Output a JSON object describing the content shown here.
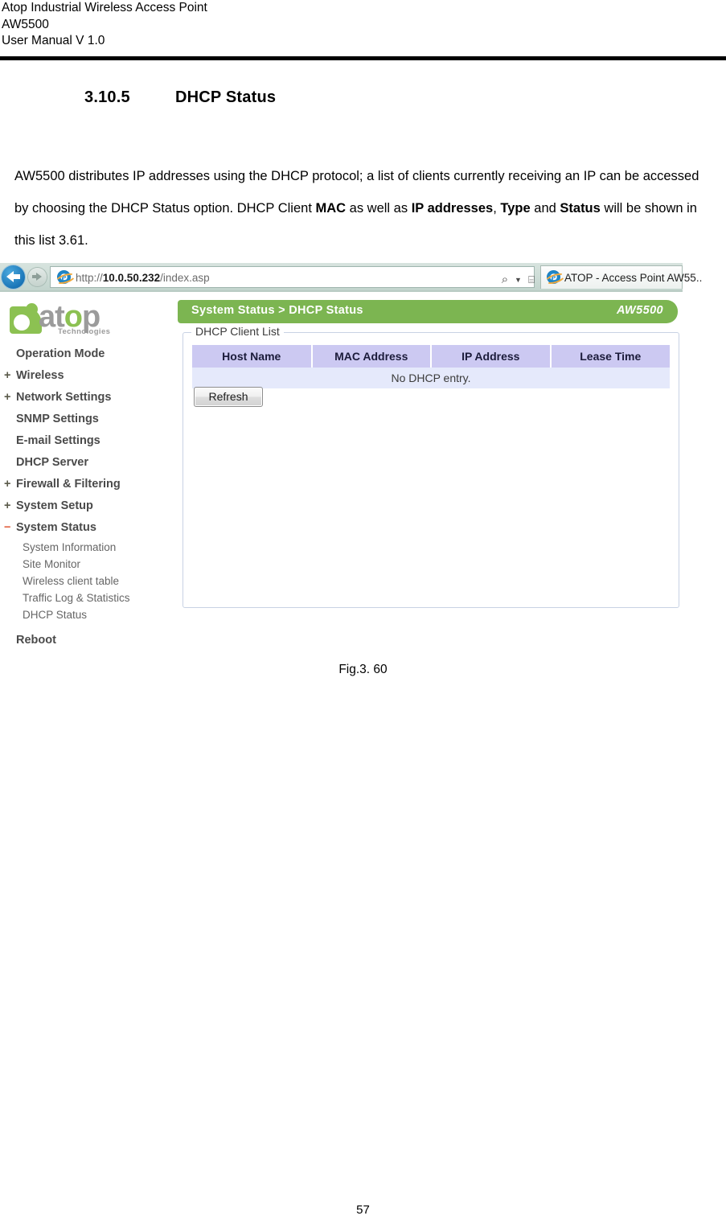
{
  "document": {
    "header_lines": [
      "Atop Industrial Wireless Access Point",
      "AW5500",
      "User Manual V 1.0"
    ],
    "section": {
      "number": "3.10.5",
      "title": "DHCP Status"
    },
    "paragraph": {
      "part1": "AW5500 distributes IP addresses using the DHCP protocol; a list of clients currently receiving an IP can be accessed by choosing the DHCP Status option. DHCP Client ",
      "bold1": "MAC",
      "part2": " as well as ",
      "bold2": "IP addresses",
      "part3": ", ",
      "bold3": "Type",
      "part4": " and ",
      "bold4": "Status",
      "part5": " will be shown in this list 3.61."
    },
    "figure_caption": "Fig.3. 60",
    "page_number": "57"
  },
  "browser": {
    "back_icon": "back-arrow-icon",
    "forward_icon": "forward-arrow-icon",
    "url": {
      "scheme": "http://",
      "host": "10.0.50.232",
      "path": "/index.asp",
      "full": "http://10.0.50.232/index.asp"
    },
    "address_icons": {
      "search": "⌕",
      "caret": "▼",
      "compatibility": "⌸",
      "refresh": "↻",
      "stop": "✕"
    },
    "tab": {
      "title": "ATOP - Access Point AW55..",
      "favicon": "ie-logo-icon"
    }
  },
  "device_ui": {
    "logo": {
      "word_at": "at",
      "word_o": "o",
      "word_p": "p",
      "subtitle": "Technologies",
      "green": "#8cc152",
      "gray": "#9b9b9b"
    },
    "titlebar": {
      "breadcrumb": "System Status > DHCP Status",
      "model": "AW5500",
      "color": "#7cb551"
    },
    "sidebar": {
      "items": [
        {
          "label": "Operation Mode",
          "marker": ""
        },
        {
          "label": "Wireless",
          "marker": "+"
        },
        {
          "label": "Network Settings",
          "marker": "+"
        },
        {
          "label": "SNMP Settings",
          "marker": ""
        },
        {
          "label": "E-mail Settings",
          "marker": ""
        },
        {
          "label": "DHCP Server",
          "marker": ""
        },
        {
          "label": "Firewall & Filtering",
          "marker": "+"
        },
        {
          "label": "System Setup",
          "marker": "+"
        },
        {
          "label": "System Status",
          "marker": "−"
        }
      ],
      "sub_items": [
        "System Information",
        "Site Monitor",
        "Wireless client table",
        "Traffic Log & Statistics",
        "DHCP Status"
      ],
      "reboot": "Reboot"
    },
    "panel": {
      "legend": "DHCP Client List",
      "table": {
        "headers": [
          "Host Name",
          "MAC Address",
          "IP Address",
          "Lease Time"
        ],
        "empty_message": "No DHCP entry.",
        "rows": [],
        "header_bg": "#ccc9f2",
        "row_bg": "#e5e9fb"
      },
      "refresh_button": "Refresh"
    }
  }
}
